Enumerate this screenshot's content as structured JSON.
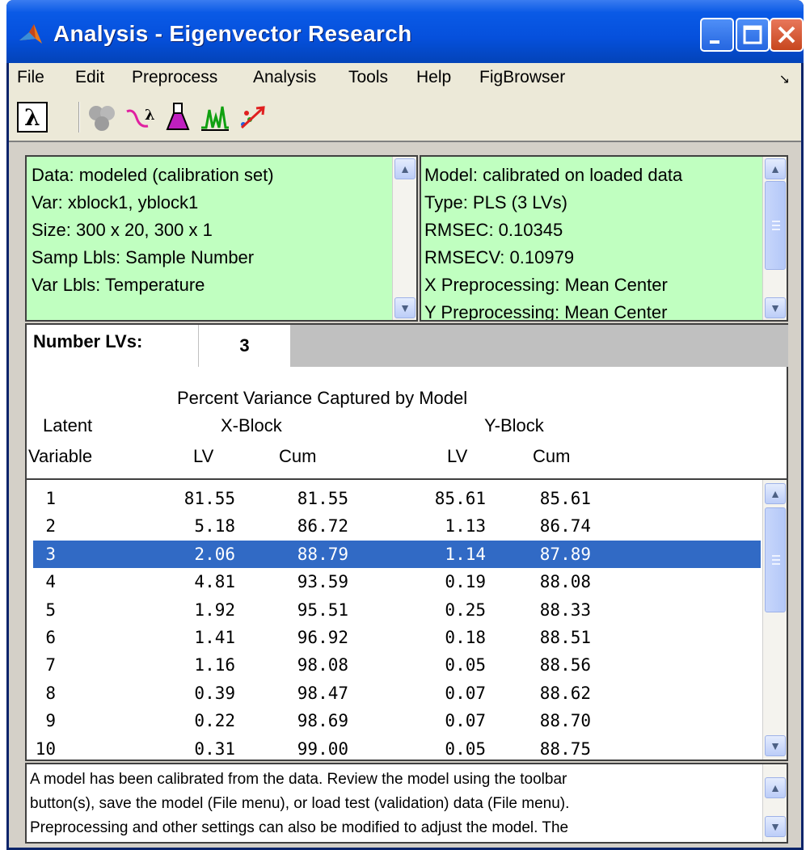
{
  "window": {
    "title": "Analysis - Eigenvector Research"
  },
  "menubar": {
    "items": [
      "File",
      "Edit",
      "Preprocess",
      "Analysis",
      "Tools",
      "Help",
      "FigBrowser"
    ],
    "overflow_icon": "dock-arrow-icon"
  },
  "toolbar": {
    "icons": [
      "lambda-icon",
      "gear-cluster-icon",
      "spectra-lambda-icon",
      "flask-icon",
      "peaks-plot-icon",
      "scatter-arrow-icon"
    ]
  },
  "data_panel": {
    "lines": [
      "Data: modeled (calibration set)",
      "Var: xblock1, yblock1",
      "Size: 300 x 20, 300 x 1",
      "Samp Lbls: Sample Number",
      "Var Lbls: Temperature"
    ]
  },
  "model_panel": {
    "lines": [
      "Model: calibrated on loaded data",
      "Type: PLS (3 LVs)",
      "RMSEC: 0.10345",
      "RMSECV: 0.10979",
      "X Preprocessing: Mean Center",
      "Y Preprocessing: Mean Center"
    ]
  },
  "lv_control": {
    "label": "Number LVs:",
    "value": "3"
  },
  "table_header": {
    "title": "Percent Variance Captured by Model",
    "latent": "Latent",
    "variable": "Variable",
    "xblock": "X-Block",
    "yblock": "Y-Block",
    "lv": "LV",
    "cum": "Cum"
  },
  "table": {
    "selected_row": 2,
    "rows": [
      [
        "1",
        "81.55",
        "81.55",
        "85.61",
        "85.61"
      ],
      [
        "2",
        "5.18",
        "86.72",
        "1.13",
        "86.74"
      ],
      [
        "3",
        "2.06",
        "88.79",
        "1.14",
        "87.89"
      ],
      [
        "4",
        "4.81",
        "93.59",
        "0.19",
        "88.08"
      ],
      [
        "5",
        "1.92",
        "95.51",
        "0.25",
        "88.33"
      ],
      [
        "6",
        "1.41",
        "96.92",
        "0.18",
        "88.51"
      ],
      [
        "7",
        "1.16",
        "98.08",
        "0.05",
        "88.56"
      ],
      [
        "8",
        "0.39",
        "98.47",
        "0.07",
        "88.62"
      ],
      [
        "9",
        "0.22",
        "98.69",
        "0.07",
        "88.70"
      ],
      [
        "10",
        "0.31",
        "99.00",
        "0.05",
        "88.75"
      ]
    ]
  },
  "status": {
    "lines": [
      "A model has been calibrated from the data. Review the model using the toolbar",
      "button(s), save the model (File menu), or load test (validation) data (File menu).",
      "Preprocessing and other settings can also be modified to adjust the model. The"
    ]
  },
  "colors": {
    "title_bar": "#0550dc",
    "panel_bg": "#c0ffc0",
    "selection": "#316ac5"
  }
}
